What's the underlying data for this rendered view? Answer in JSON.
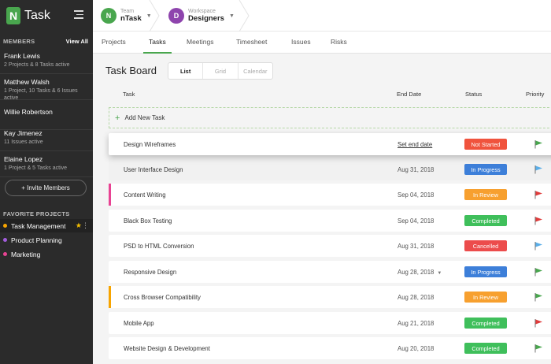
{
  "app": {
    "logo_letter": "N",
    "name": "Task"
  },
  "sidebar": {
    "members_heading": "MEMBERS",
    "view_all": "View All",
    "members": [
      {
        "name": "Frank Lewis",
        "desc": "2 Projects & 8 Tasks active"
      },
      {
        "name": "Matthew Walsh",
        "desc": "1 Project, 10 Tasks & 6 Issues active"
      },
      {
        "name": "Willie Robertson",
        "desc": ""
      },
      {
        "name": "Kay Jimenez",
        "desc": "11 Issues active"
      },
      {
        "name": "Elaine Lopez",
        "desc": "1 Project & 5 Tasks active"
      }
    ],
    "invite_label": "+ Invite Members",
    "favorites_heading": "FAVORITE PROJECTS",
    "favorites": [
      {
        "name": "Task Management",
        "color": "#f7a400"
      },
      {
        "name": "Product Planning",
        "color": "#a25ddc"
      },
      {
        "name": "Marketing",
        "color": "#e84393"
      }
    ]
  },
  "header": {
    "team": {
      "avatar_letter": "N",
      "label": "Team",
      "value": "nTask",
      "color": "#49a64e"
    },
    "workspace": {
      "avatar_letter": "D",
      "label": "Workspace",
      "value": "Designers",
      "color": "#8e44ad"
    }
  },
  "tabs": [
    "Projects",
    "Tasks",
    "Meetings",
    "Timesheet",
    "Issues",
    "Risks"
  ],
  "active_tab": "Tasks",
  "board": {
    "title": "Task Board",
    "views": [
      "List",
      "Grid",
      "Calendar"
    ],
    "active_view": "List",
    "columns": {
      "task": "Task",
      "end_date": "End Date",
      "status": "Status",
      "priority": "Priority"
    },
    "add_task_label": "Add New Task"
  },
  "colors": {
    "accent": "#49a64e",
    "not_started": "#f0533d",
    "in_progress": "#3d7fd9",
    "in_review": "#f7a02f",
    "completed": "#3fbf5b",
    "cancelled": "#ec4c4c"
  },
  "tasks": [
    {
      "name": "Design Wireframes",
      "end_date": "Set end date",
      "status": "Not Started",
      "status_color": "#f0533d",
      "priority_color": "#49a64e",
      "bar_color": "",
      "date_link": true
    },
    {
      "name": "User Interface Design",
      "end_date": "Aug 31, 2018",
      "status": "In Progress",
      "status_color": "#3d7fd9",
      "priority_color": "#5aaee8",
      "bar_color": ""
    },
    {
      "name": "Content Writing",
      "end_date": "Sep 04, 2018",
      "status": "In Review",
      "status_color": "#f7a02f",
      "priority_color": "#e03c3c",
      "bar_color": "#e84393"
    },
    {
      "name": "Black Box Testing",
      "end_date": "Sep 04, 2018",
      "status": "Completed",
      "status_color": "#3fbf5b",
      "priority_color": "#e03c3c",
      "bar_color": ""
    },
    {
      "name": "PSD to HTML Conversion",
      "end_date": "Aug 31, 2018",
      "status": "Cancelled",
      "status_color": "#ec4c4c",
      "priority_color": "#5aaee8",
      "bar_color": ""
    },
    {
      "name": "Responsive Design",
      "end_date": "Aug 28, 2018",
      "status": "In Progress",
      "status_color": "#3d7fd9",
      "priority_color": "#49a64e",
      "bar_color": "",
      "date_caret": true
    },
    {
      "name": "Cross Browser Compatibility",
      "end_date": "Aug 28, 2018",
      "status": "In Review",
      "status_color": "#f7a02f",
      "priority_color": "#49a64e",
      "bar_color": "#f7a400"
    },
    {
      "name": "Mobile App",
      "end_date": "Aug 21, 2018",
      "status": "Completed",
      "status_color": "#3fbf5b",
      "priority_color": "#e03c3c",
      "bar_color": ""
    },
    {
      "name": "Website Design & Development",
      "end_date": "Aug 20, 2018",
      "status": "Completed",
      "status_color": "#3fbf5b",
      "priority_color": "#49a64e",
      "bar_color": ""
    }
  ]
}
